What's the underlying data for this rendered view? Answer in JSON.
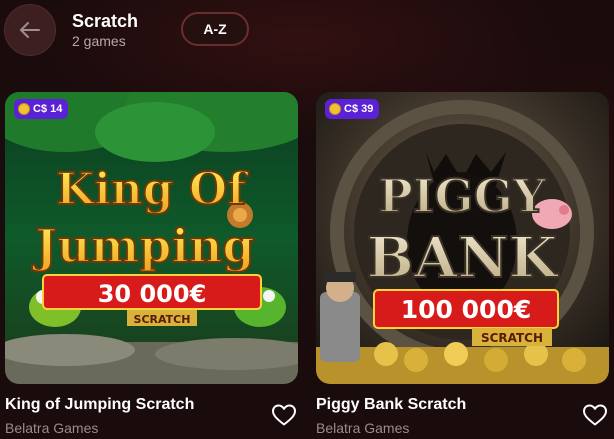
{
  "header": {
    "title": "Scratch",
    "subtitle": "2 games",
    "sort_label": "A-Z",
    "back_icon": "arrow-left-icon"
  },
  "games": [
    {
      "title": "King of Jumping Scratch",
      "provider": "Belatra Games",
      "price": "C$ 14",
      "art": {
        "line1": "King Of",
        "line2": "Jumping",
        "prize": "30 000€",
        "tag": "SCRATCH"
      }
    },
    {
      "title": "Piggy Bank Scratch",
      "provider": "Belatra Games",
      "price": "C$ 39",
      "art": {
        "line1": "PIGGY",
        "line2": "BANK",
        "prize": "100 000€",
        "tag": "SCRATCH"
      }
    }
  ],
  "colors": {
    "background": "#1a0b0c",
    "badge": "#5b21d6",
    "sort_border": "#6b2d31"
  }
}
